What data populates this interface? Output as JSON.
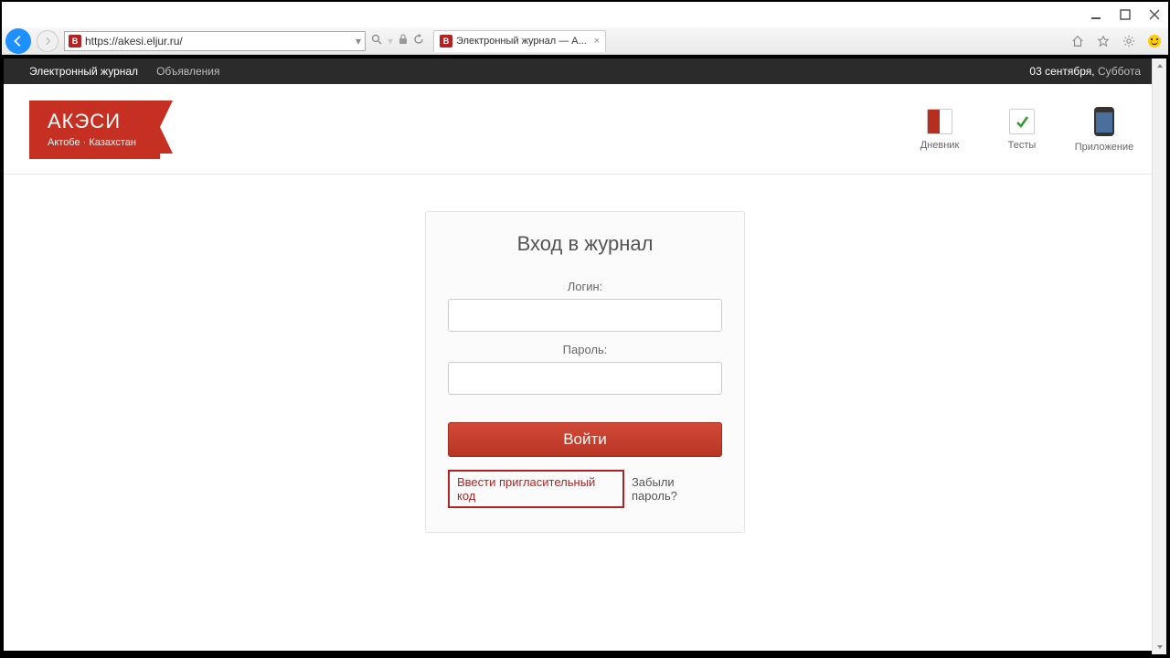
{
  "browser": {
    "url": "https://akesi.eljur.ru/",
    "tab_title": "Электронный журнал — А...",
    "site_icon_letter": "B"
  },
  "sitebar": {
    "journal": "Электронный журнал",
    "announcements": "Объявления",
    "date": "03 сентября,",
    "weekday": "Суббота"
  },
  "ribbon": {
    "title": "АКЭСИ",
    "subtitle": "Актобе · Казахстан"
  },
  "apps": {
    "diary": "Дневник",
    "tests": "Тесты",
    "mobile": "Приложение"
  },
  "login": {
    "heading": "Вход в журнал",
    "login_label": "Логин:",
    "password_label": "Пароль:",
    "submit": "Войти",
    "invite": "Ввести пригласительный код",
    "forgot": "Забыли пароль?"
  }
}
